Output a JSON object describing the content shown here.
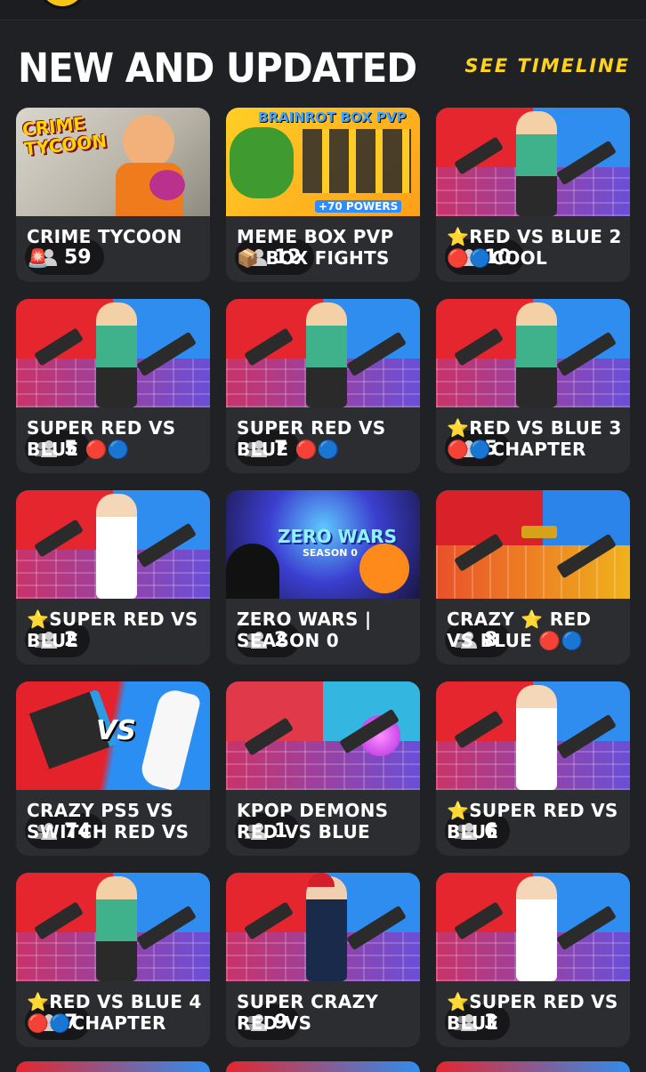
{
  "header": {
    "title": "NEW AND UPDATED",
    "link_label": "SEE TIMELINE"
  },
  "colors": {
    "background": "#202124",
    "card": "#2c2d31",
    "accent": "#ffd21e"
  },
  "cards": [
    {
      "title": "CRIME TYCOON 🚨",
      "players": "59",
      "art": "crime",
      "art_text": "CRIME TYCOON"
    },
    {
      "title": "MEME BOX PVP 📦 BOX FIGHTS",
      "players": "12",
      "art": "meme",
      "art_text": "BRAINROT BOX PVP",
      "art_sub": "+70 POWERS"
    },
    {
      "title": "⭐RED VS BLUE 2 🔴🔵COOL",
      "players": "10",
      "art": "redblue"
    },
    {
      "title": "SUPER RED VS BLUE 🔴🔵",
      "players": "5",
      "art": "redblue"
    },
    {
      "title": "SUPER RED VS BLUE 🔴🔵",
      "players": "7",
      "art": "redblue"
    },
    {
      "title": "⭐RED VS BLUE 3 🔴🔵CHAPTER",
      "players": "5",
      "art": "redblue"
    },
    {
      "title": "⭐SUPER RED VS BLUE",
      "players": "2",
      "art": "redblue-white"
    },
    {
      "title": "ZERO WARS | SEASON 0",
      "players": "2",
      "art": "zero",
      "art_text": "ZERO WARS",
      "art_sub": "SEASON 0"
    },
    {
      "title": "CRAZY ⭐ RED VS BLUE 🔴🔵",
      "players": "8",
      "art": "redblue-room"
    },
    {
      "title": "CRAZY PS5 VS SWITCH RED VS",
      "players": "74",
      "art": "ps5",
      "art_text": "VS"
    },
    {
      "title": "KPOP DEMONS RED VS BLUE",
      "players": "1",
      "art": "kpop"
    },
    {
      "title": "⭐SUPER RED VS BLUE",
      "players": "6",
      "art": "redblue-white"
    },
    {
      "title": "⭐RED VS BLUE 4 🔴🔵CHAPTER",
      "players": "7",
      "art": "redblue"
    },
    {
      "title": "SUPER CRAZY RED VS",
      "players": "9",
      "art": "redblue-girl"
    },
    {
      "title": "⭐SUPER RED VS BLUE",
      "players": "3",
      "art": "redblue-white"
    }
  ]
}
